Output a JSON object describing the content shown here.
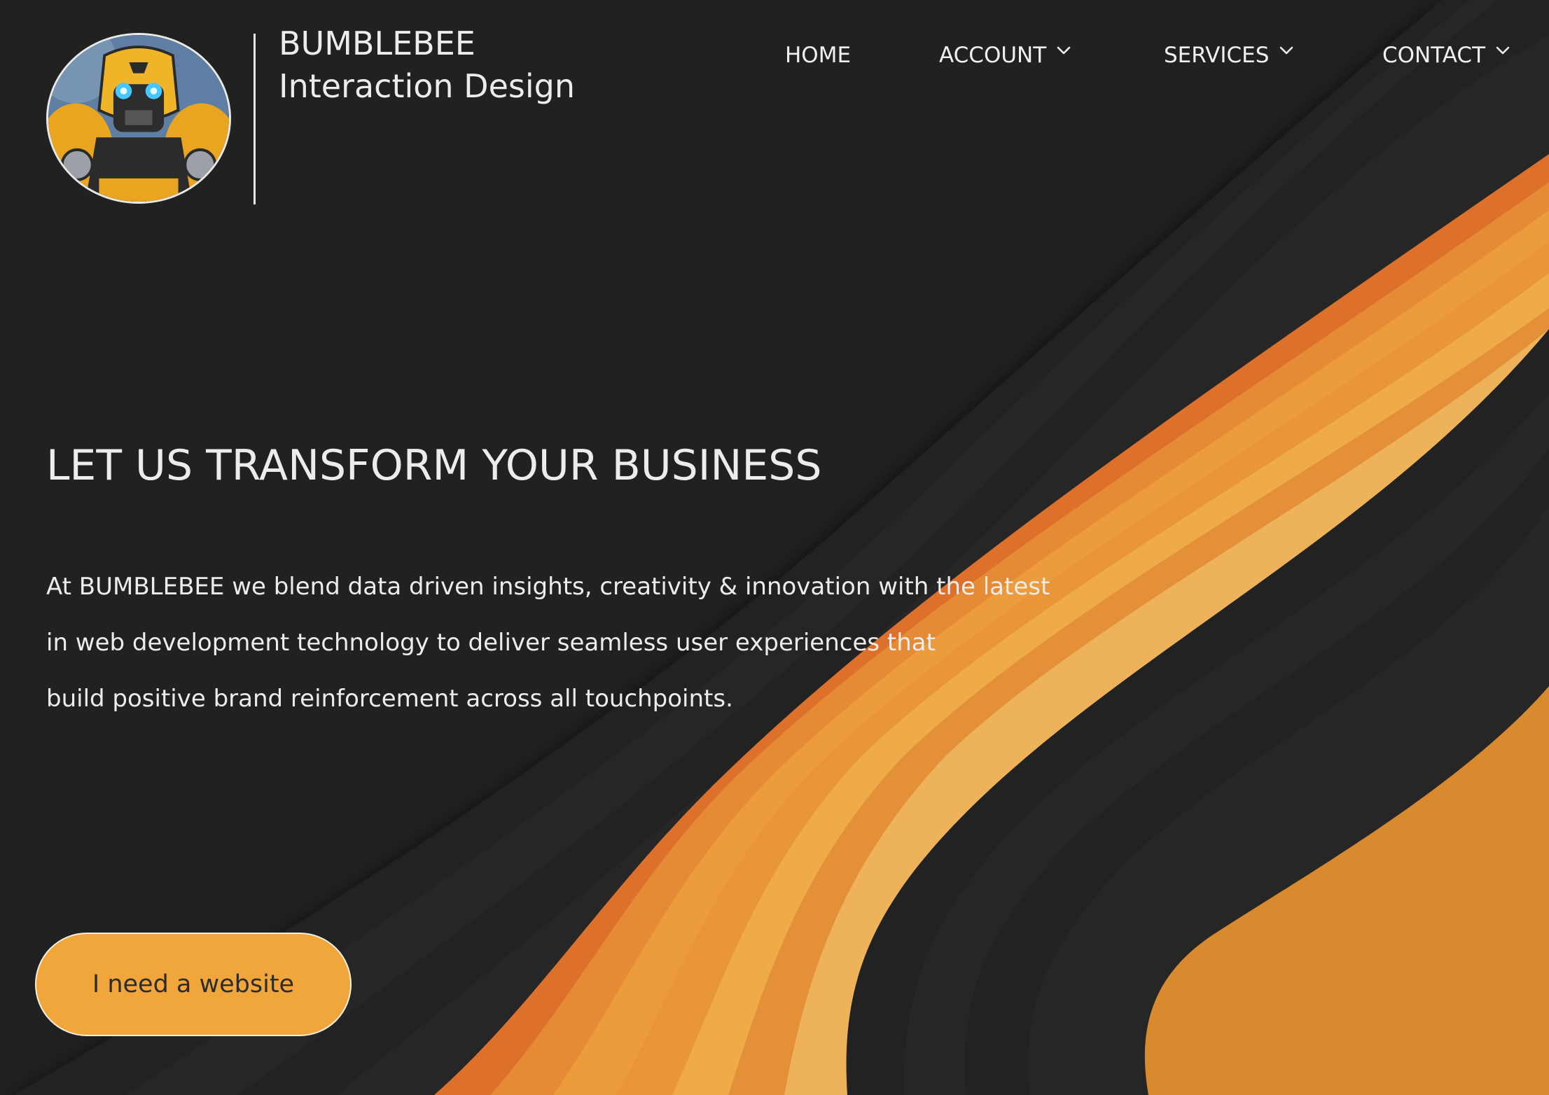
{
  "brand": {
    "name": "BUMBLEBEE",
    "tagline": "Interaction Design",
    "logo_alt": "Bumblebee robot avatar"
  },
  "nav": {
    "items": [
      {
        "label": "HOME",
        "has_dropdown": false
      },
      {
        "label": "ACCOUNT",
        "has_dropdown": true
      },
      {
        "label": "SERVICES",
        "has_dropdown": true
      },
      {
        "label": "CONTACT",
        "has_dropdown": true
      }
    ],
    "dropdown_icon": "chevron-down-icon"
  },
  "hero": {
    "headline": "LET US TRANSFORM YOUR BUSINESS",
    "intro_lines": [
      "At BUMBLEBEE we blend data driven insights, creativity & innovation with the latest",
      "in web development technology to deliver seamless user experiences that",
      "build positive brand reinforcement across all touchpoints."
    ],
    "cta_label": "I need a website"
  },
  "colors": {
    "background": "#212121",
    "accent": "#f0a63a",
    "accent_deep": "#d98a2f",
    "text": "#ececec"
  }
}
